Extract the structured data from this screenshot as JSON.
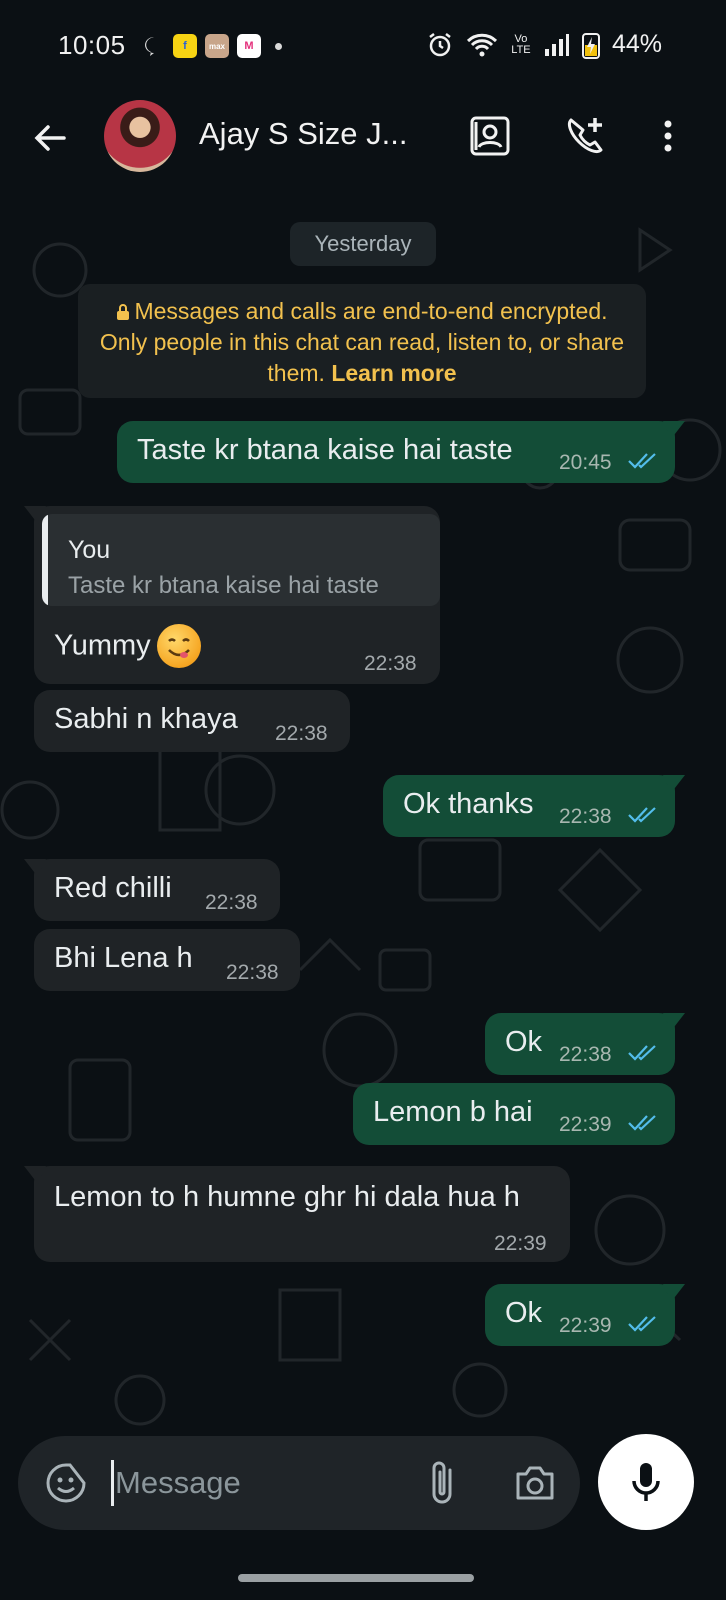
{
  "status_bar": {
    "time": "10:05",
    "network": "Vo LTE",
    "battery": "44%"
  },
  "header": {
    "contact_name": "Ajay S Size   J..."
  },
  "chat": {
    "date_chip": "Yesterday",
    "encryption_notice": "Messages and calls are end-to-end encrypted. Only people in this chat can read, listen to, or share them.",
    "encryption_link": "Learn more",
    "messages": [
      {
        "direction": "out",
        "text": "Taste kr btana kaise hai taste",
        "time": "20:45"
      },
      {
        "direction": "in",
        "quote_author": "You",
        "quote_text": "Taste kr btana kaise hai taste",
        "text": "Yummy",
        "time": "22:38"
      },
      {
        "direction": "in",
        "text": "Sabhi n khaya",
        "time": "22:38"
      },
      {
        "direction": "out",
        "text": "Ok thanks",
        "time": "22:38"
      },
      {
        "direction": "in",
        "text": "Red chilli",
        "time": "22:38"
      },
      {
        "direction": "in",
        "text": "Bhi Lena h",
        "time": "22:38"
      },
      {
        "direction": "out",
        "text": "Ok",
        "time": "22:38"
      },
      {
        "direction": "out",
        "text": "Lemon b hai",
        "time": "22:39"
      },
      {
        "direction": "in",
        "text": "Lemon to h humne ghr hi dala hua h",
        "time": "22:39"
      },
      {
        "direction": "out",
        "text": "Ok",
        "time": "22:39"
      }
    ]
  },
  "composer": {
    "placeholder": "Message"
  },
  "colors": {
    "outgoing_bubble": "#134d37",
    "incoming_bubble": "#1f2326",
    "read_ticks": "#53bdeb",
    "encryption_text": "#f2c14e"
  }
}
